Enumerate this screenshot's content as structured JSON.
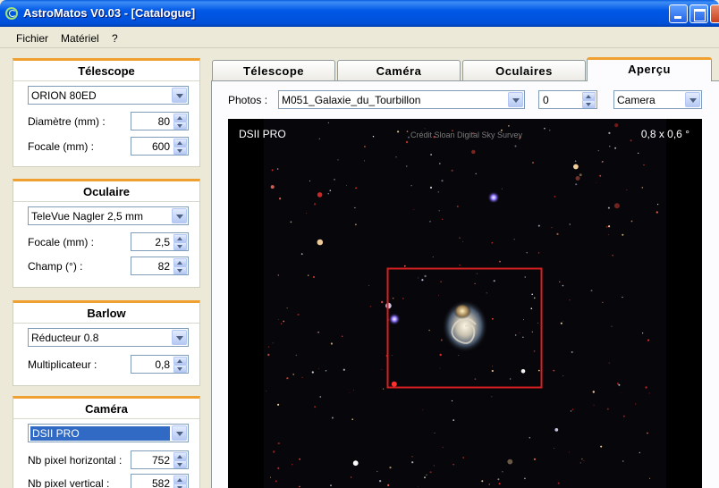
{
  "window": {
    "title": "AstroMatos V0.03 - [Catalogue]"
  },
  "menu": {
    "items": [
      "Fichier",
      "Matériel",
      "?"
    ]
  },
  "telescope": {
    "title": "Télescope",
    "model": "ORION 80ED",
    "diameter_label": "Diamètre (mm) :",
    "diameter_value": "80",
    "focal_label": "Focale (mm) :",
    "focal_value": "600"
  },
  "eyepiece": {
    "title": "Oculaire",
    "model": "TeleVue Nagler 2,5 mm",
    "focal_label": "Focale (mm) :",
    "focal_value": "2,5",
    "field_label": "Champ (°) :",
    "field_value": "82"
  },
  "barlow": {
    "title": "Barlow",
    "model": "Réducteur 0.8",
    "mult_label": "Multiplicateur :",
    "mult_value": "0,8"
  },
  "camera": {
    "title": "Caméra",
    "model": "DSII PRO",
    "hpix_label": "Nb pixel horizontal :",
    "hpix_value": "752",
    "vpix_label": "Nb pixel vertical :",
    "vpix_value": "582"
  },
  "tabs": [
    {
      "label": "Télescope",
      "active": false
    },
    {
      "label": "Caméra",
      "active": false
    },
    {
      "label": "Oculaires",
      "active": false
    },
    {
      "label": "Aperçu",
      "active": true
    }
  ],
  "preview": {
    "photos_label": "Photos :",
    "photo_value": "M051_Galaxie_du_Tourbillon",
    "index_value": "0",
    "mode_value": "Camera",
    "overlay_left": "DSII PRO",
    "overlay_credit": "Crédit Sloan Digital Sky Survey",
    "overlay_right": "0,8 x 0,6 °"
  },
  "colors": {
    "frame": "#d42020",
    "tab_accent": "#f0a030",
    "titlebar": "#0058e6",
    "selection": "#316ac5"
  }
}
